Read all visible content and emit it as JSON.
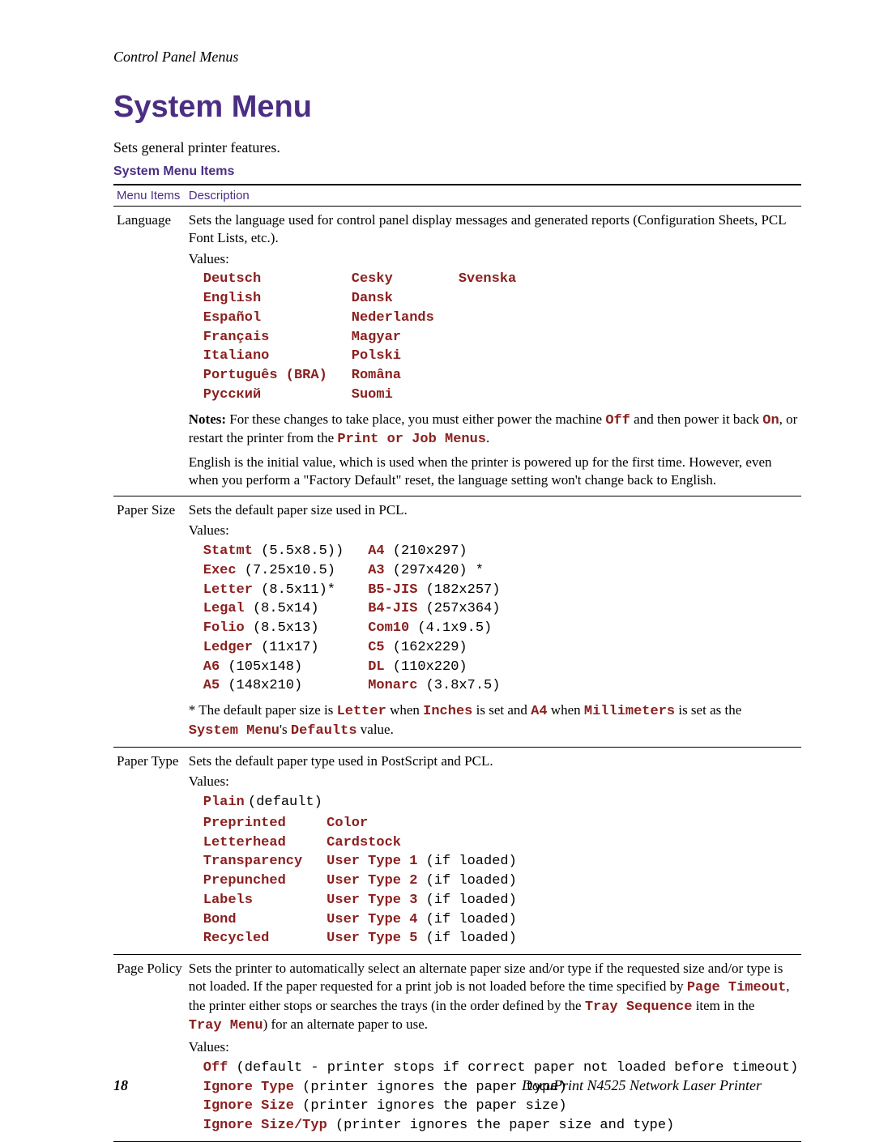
{
  "header": {
    "running": "Control Panel Menus"
  },
  "title": "System Menu",
  "intro": "Sets general printer features.",
  "table_caption": "System Menu Items",
  "columns": {
    "item": "Menu Items",
    "desc": "Description"
  },
  "language": {
    "name": "Language",
    "desc": "Sets the language used for control panel display messages and generated reports (Configuration Sheets, PCL Font Lists, etc.).",
    "values_label": "Values:",
    "col1": [
      "Deutsch",
      "English",
      "Español",
      "Français",
      "Italiano",
      "Português (BRA)",
      "Русский"
    ],
    "col2": [
      "Cesky",
      "Dansk",
      "Nederlands",
      "Magyar",
      "Polski",
      "Româna",
      "Suomi"
    ],
    "col3": [
      "Svenska"
    ],
    "note_label": "Notes:",
    "note_1a": " For these changes to take place, you must either power the machine ",
    "note_off": "Off",
    "note_1b": " and then power it back ",
    "note_on": "On",
    "note_1c": ", or restart the printer from the ",
    "note_job": "Print or Job Menus",
    "note_1d": ".",
    "note2": "English is the initial value, which is used when the printer is powered up for the first time. However, even when you perform a \"Factory Default\" reset, the language setting won't change back to English."
  },
  "papersize": {
    "name": "Paper Size",
    "desc": "Sets the default paper size used in PCL.",
    "values_label": "Values:",
    "col1": [
      {
        "k": "Statmt",
        "v": "(5.5x8.5))"
      },
      {
        "k": "Exec",
        "v": "(7.25x10.5)"
      },
      {
        "k": "Letter",
        "v": "(8.5x11)*"
      },
      {
        "k": "Legal",
        "v": "(8.5x14)"
      },
      {
        "k": "Folio",
        "v": "(8.5x13)"
      },
      {
        "k": "Ledger",
        "v": "(11x17)"
      },
      {
        "k": "A6",
        "v": "(105x148)"
      },
      {
        "k": "A5",
        "v": "(148x210)"
      }
    ],
    "col2": [
      {
        "k": "A4",
        "v": "(210x297)"
      },
      {
        "k": "A3",
        "v": "(297x420) *"
      },
      {
        "k": "B5-JIS",
        "v": "(182x257)"
      },
      {
        "k": "B4-JIS",
        "v": "(257x364)"
      },
      {
        "k": "Com10",
        "v": "(4.1x9.5)"
      },
      {
        "k": "C5",
        "v": "(162x229)"
      },
      {
        "k": "DL",
        "v": "(110x220)"
      },
      {
        "k": "Monarc",
        "v": "(3.8x7.5)"
      }
    ],
    "foot_a": "* The default paper size is ",
    "foot_letter": "Letter",
    "foot_b": " when ",
    "foot_inches": "Inches",
    "foot_c": " is set and ",
    "foot_a4": "A4",
    "foot_d": " when ",
    "foot_mm": "Millimeters",
    "foot_e": " is set as the ",
    "foot_sys": "System Menu",
    "foot_f": "'s ",
    "foot_def": "Defaults",
    "foot_g": " value."
  },
  "papertype": {
    "name": "Paper Type",
    "desc": "Sets the default paper type used in PostScript and PCL.",
    "values_label": "Values:",
    "plain_k": "Plain",
    "plain_v": "(default)",
    "col1": [
      "Preprinted",
      "Letterhead",
      "Transparency",
      "Prepunched",
      "Labels",
      "Bond",
      "Recycled"
    ],
    "col2": [
      {
        "k": "Color",
        "v": ""
      },
      {
        "k": "Cardstock",
        "v": ""
      },
      {
        "k": "User Type 1",
        "v": "(if loaded)"
      },
      {
        "k": "User Type 2",
        "v": "(if loaded)"
      },
      {
        "k": "User Type 3",
        "v": "(if loaded)"
      },
      {
        "k": "User Type 4",
        "v": "(if loaded)"
      },
      {
        "k": "User Type 5",
        "v": "(if loaded)"
      }
    ]
  },
  "pagepolicy": {
    "name": "Page Policy",
    "d1": "Sets the printer to automatically select an alternate paper size and/or type if the requested size and/or type is not loaded. If the paper requested for a print job is not loaded before the time specified by ",
    "pt": "Page Timeout",
    "d2": ", the printer either stops or searches the trays (in the order defined by the ",
    "ts": "Tray Sequence",
    "d3": " item in the ",
    "tm": "Tray Menu",
    "d4": ") for an alternate paper to use.",
    "values_label": "Values:",
    "rows": [
      {
        "k": "Off",
        "v": "(default - printer stops if correct paper not loaded before timeout)"
      },
      {
        "k": "Ignore Type",
        "v": "(printer ignores the paper type)"
      },
      {
        "k": "Ignore Size",
        "v": "(printer ignores the paper size)"
      },
      {
        "k": "Ignore Size/Typ",
        "v": "(printer ignores the paper size and type)"
      }
    ]
  },
  "footer": {
    "page": "18",
    "doc": "DocuPrint N4525 Network Laser Printer"
  }
}
